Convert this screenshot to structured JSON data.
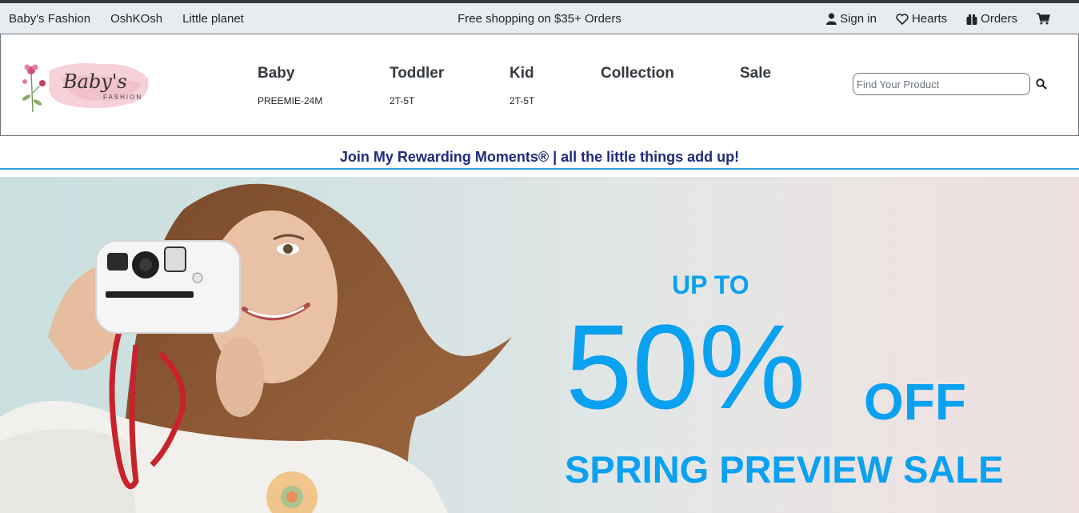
{
  "topbar": {
    "brands": [
      "Baby's Fashion",
      "OshKOsh",
      "Little planet"
    ],
    "promo": "Free shopping on $35+ Orders",
    "account": {
      "sign_in": "Sign in",
      "hearts": "Hearts",
      "orders": "Orders"
    }
  },
  "header": {
    "logo_text": "Baby's",
    "logo_subtext": "FASHION",
    "nav": [
      {
        "title": "Baby",
        "sub": "PREEMIE-24M"
      },
      {
        "title": "Toddler",
        "sub": "2T-5T"
      },
      {
        "title": "Kid",
        "sub": "2T-5T"
      },
      {
        "title": "Collection",
        "sub": ""
      },
      {
        "title": "Sale",
        "sub": ""
      }
    ],
    "search_placeholder": "Find Your Product"
  },
  "rewards": {
    "text": "Join My Rewarding Moments® | all the little things add up!"
  },
  "hero": {
    "upto": "UP TO",
    "percent": "50%",
    "off": "OFF",
    "sale": "SPRING PREVIEW SALE",
    "accent_color": "#0aa1f0"
  }
}
